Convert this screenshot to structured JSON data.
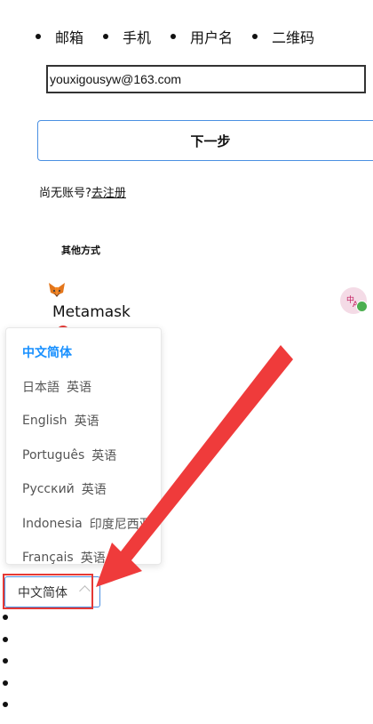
{
  "tabs": [
    {
      "label": "邮箱"
    },
    {
      "label": "手机"
    },
    {
      "label": "用户名"
    },
    {
      "label": "二维码"
    }
  ],
  "email": {
    "value": "youxigousyw@163.com"
  },
  "next_button": {
    "label": "下一步"
  },
  "no_account": {
    "text": "尚无账号?",
    "register_link": "去注册"
  },
  "other_ways": {
    "label": "其他方式"
  },
  "metamask": {
    "label": "Metamask",
    "icon": "fox-icon"
  },
  "language_dropdown": {
    "options": [
      {
        "label": "中文简体",
        "sub": "",
        "active": true
      },
      {
        "label": "日本語",
        "sub": "英语",
        "active": false
      },
      {
        "label": "English",
        "sub": "英语",
        "active": false
      },
      {
        "label": "Português",
        "sub": "英语",
        "active": false
      },
      {
        "label": "Русский",
        "sub": "英语",
        "active": false
      },
      {
        "label": "Indonesia",
        "sub": "印度尼西亚",
        "active": false
      },
      {
        "label": "Français",
        "sub": "英语",
        "active": false
      }
    ]
  },
  "language_select": {
    "value": "中文简体"
  },
  "colors": {
    "accent": "#1890ff",
    "annotation": "#e53935",
    "border": "#4a90e2"
  }
}
